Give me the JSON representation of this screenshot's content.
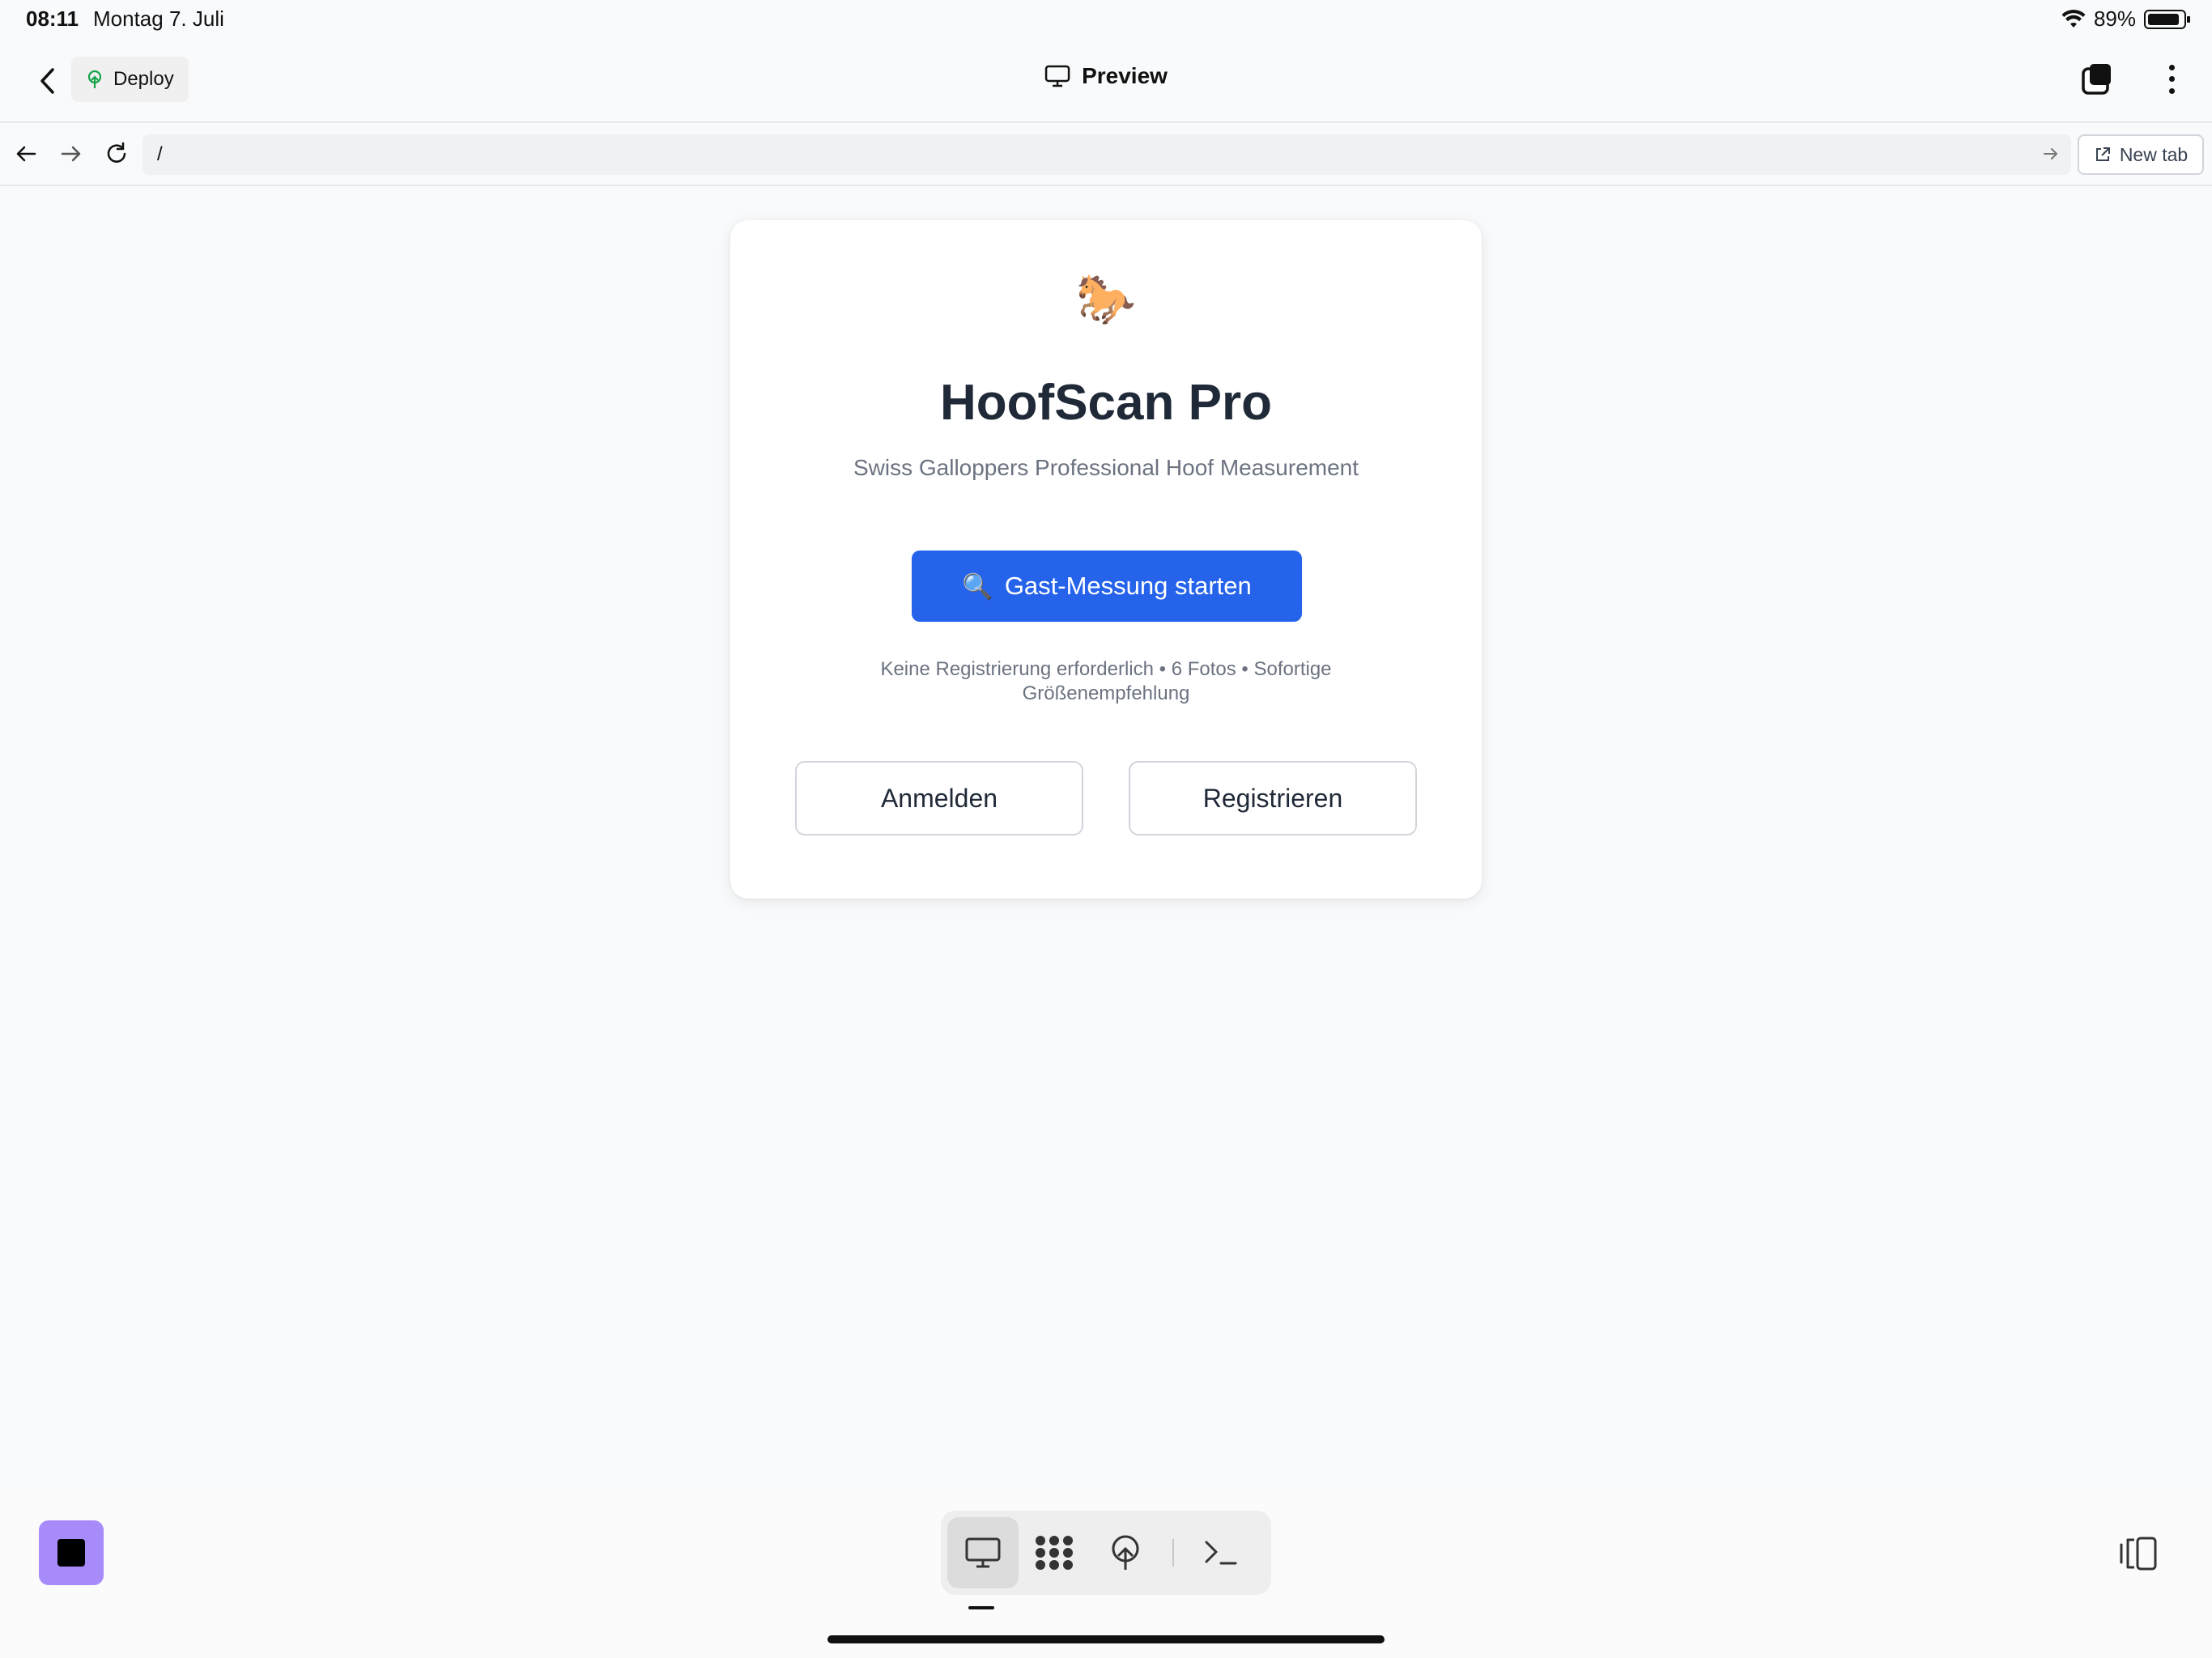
{
  "status_bar": {
    "time": "08:11",
    "date": "Montag 7. Juli",
    "battery": "89%"
  },
  "header": {
    "deploy_label": "Deploy",
    "title": "Preview"
  },
  "url_bar": {
    "url": "/",
    "new_tab_label": "New tab"
  },
  "card": {
    "logo": "🐎",
    "title": "HoofScan Pro",
    "subtitle": "Swiss Galloppers Professional Hoof Measurement",
    "guest_button": {
      "icon": "🔍",
      "label": "Gast-Messung starten"
    },
    "guest_info": "Keine Registrierung erforderlich • 6 Fotos • Sofortige Größenempfehlung",
    "login_label": "Anmelden",
    "register_label": "Registrieren"
  },
  "colors": {
    "primary": "#2563eb",
    "stop_button": "#a78bfa",
    "background": "#f9fafb"
  },
  "toolbar": {
    "items": [
      "preview-icon",
      "workspace-icon",
      "deploy-icon",
      "terminal-icon"
    ],
    "active": "preview-icon"
  }
}
